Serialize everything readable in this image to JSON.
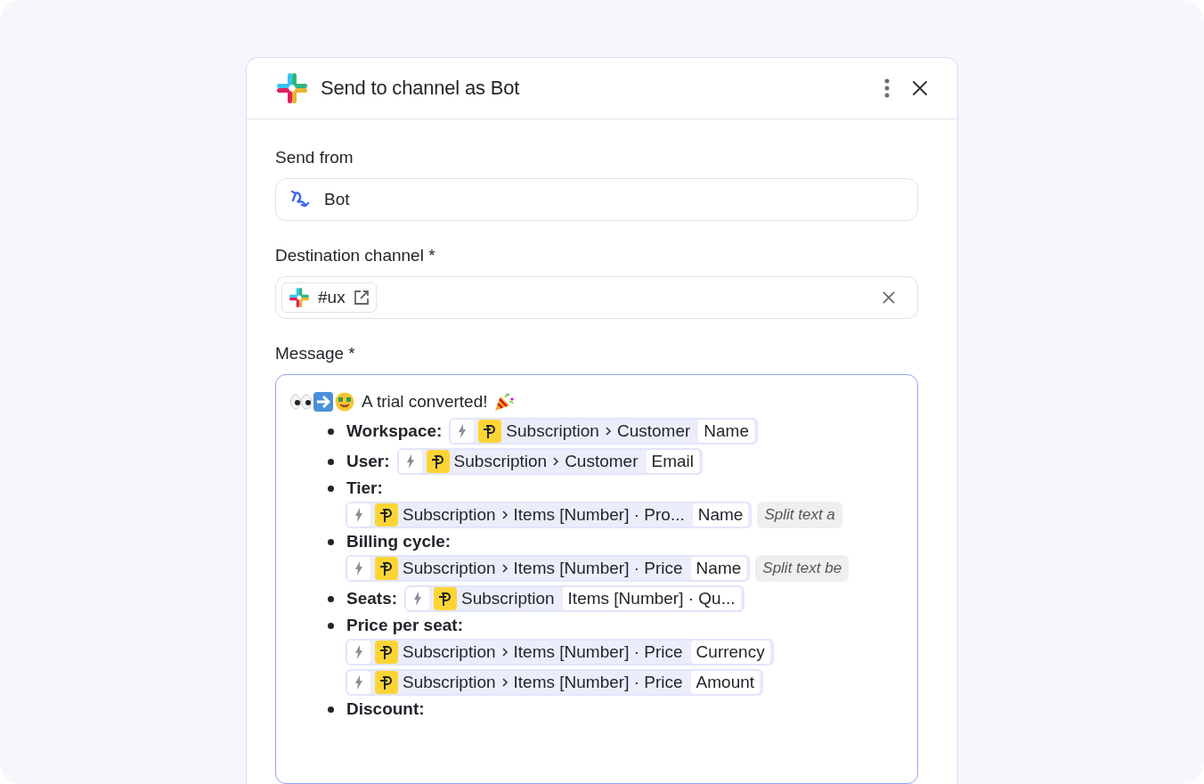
{
  "dialog": {
    "title": "Send to channel as Bot"
  },
  "send_from": {
    "label": "Send from",
    "value": "Bot"
  },
  "destination": {
    "label": "Destination channel *",
    "channel": "#ux"
  },
  "message": {
    "label": "Message *",
    "headline": "A trial converted!",
    "items": [
      {
        "label": "Workspace:",
        "kind": "inline",
        "pills": [
          {
            "path": [
              "Subscription",
              "Customer"
            ],
            "field": "Name"
          }
        ]
      },
      {
        "label": "User:",
        "kind": "inline",
        "pills": [
          {
            "path": [
              "Subscription",
              "Customer"
            ],
            "field": "Email"
          }
        ]
      },
      {
        "label": "Tier:",
        "kind": "block",
        "pills": [
          {
            "path": [
              "Subscription",
              "Items [Number] · Pro..."
            ],
            "field": "Name",
            "modifier": "Split text a"
          }
        ]
      },
      {
        "label": "Billing cycle:",
        "kind": "block",
        "pills": [
          {
            "path": [
              "Subscription",
              "Items [Number] · Price"
            ],
            "field": "Name",
            "modifier": "Split text be"
          }
        ]
      },
      {
        "label": "Seats:",
        "kind": "inline",
        "pills": [
          {
            "path": [
              "Subscription"
            ],
            "field": "Items [Number] · Qu..."
          }
        ]
      },
      {
        "label": "Price per seat:",
        "kind": "block",
        "pills": [
          {
            "path": [
              "Subscription",
              "Items [Number] · Price"
            ],
            "field": "Currency"
          },
          {
            "path": [
              "Subscription",
              "Items [Number] · Price"
            ],
            "field": "Amount"
          }
        ]
      },
      {
        "label": "Discount:",
        "kind": "block"
      }
    ]
  }
}
